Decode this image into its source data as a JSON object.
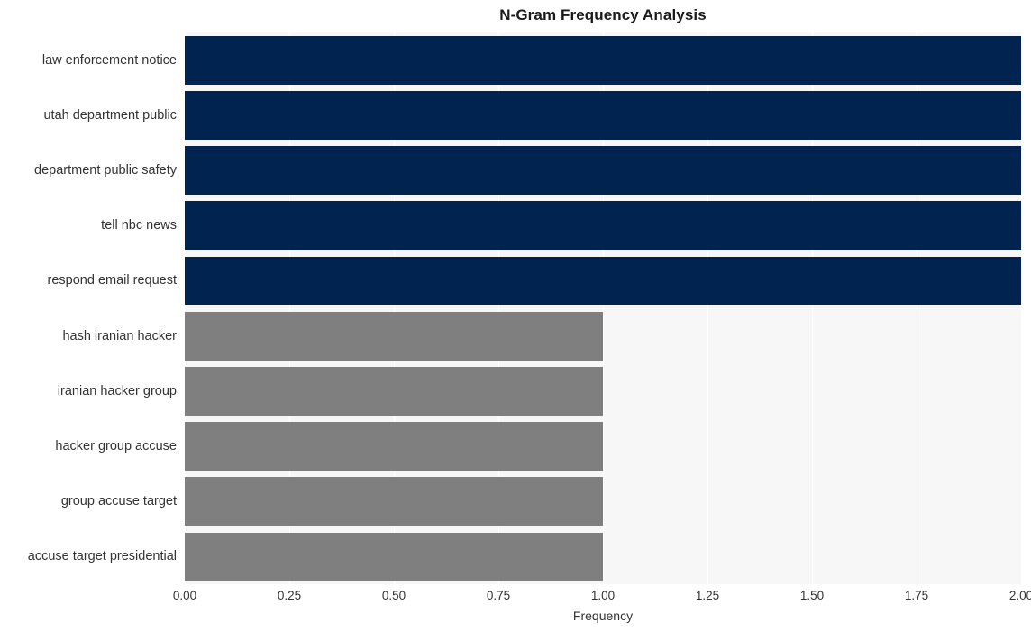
{
  "chart_data": {
    "type": "bar",
    "orientation": "horizontal",
    "title": "N-Gram Frequency Analysis",
    "xlabel": "Frequency",
    "ylabel": "",
    "categories": [
      "law enforcement notice",
      "utah department public",
      "department public safety",
      "tell nbc news",
      "respond email request",
      "hash iranian hacker",
      "iranian hacker group",
      "hacker group accuse",
      "group accuse target",
      "accuse target presidential"
    ],
    "values": [
      2,
      2,
      2,
      2,
      2,
      1,
      1,
      1,
      1,
      1
    ],
    "bar_colors": [
      "#002350",
      "#002350",
      "#002350",
      "#002350",
      "#002350",
      "#7f7f7f",
      "#7f7f7f",
      "#7f7f7f",
      "#7f7f7f",
      "#7f7f7f"
    ],
    "xlim": [
      0.0,
      2.0
    ],
    "xticks": [
      0.0,
      0.25,
      0.5,
      0.75,
      1.0,
      1.25,
      1.5,
      1.75,
      2.0
    ],
    "xtick_labels": [
      "0.00",
      "0.25",
      "0.50",
      "0.75",
      "1.00",
      "1.25",
      "1.50",
      "1.75",
      "2.00"
    ],
    "grid": true,
    "grid_axis": "x",
    "grid_color": "#ffffff",
    "legend": null,
    "plot_background": "#f7f7f7",
    "figure_background": "#ffffff"
  }
}
